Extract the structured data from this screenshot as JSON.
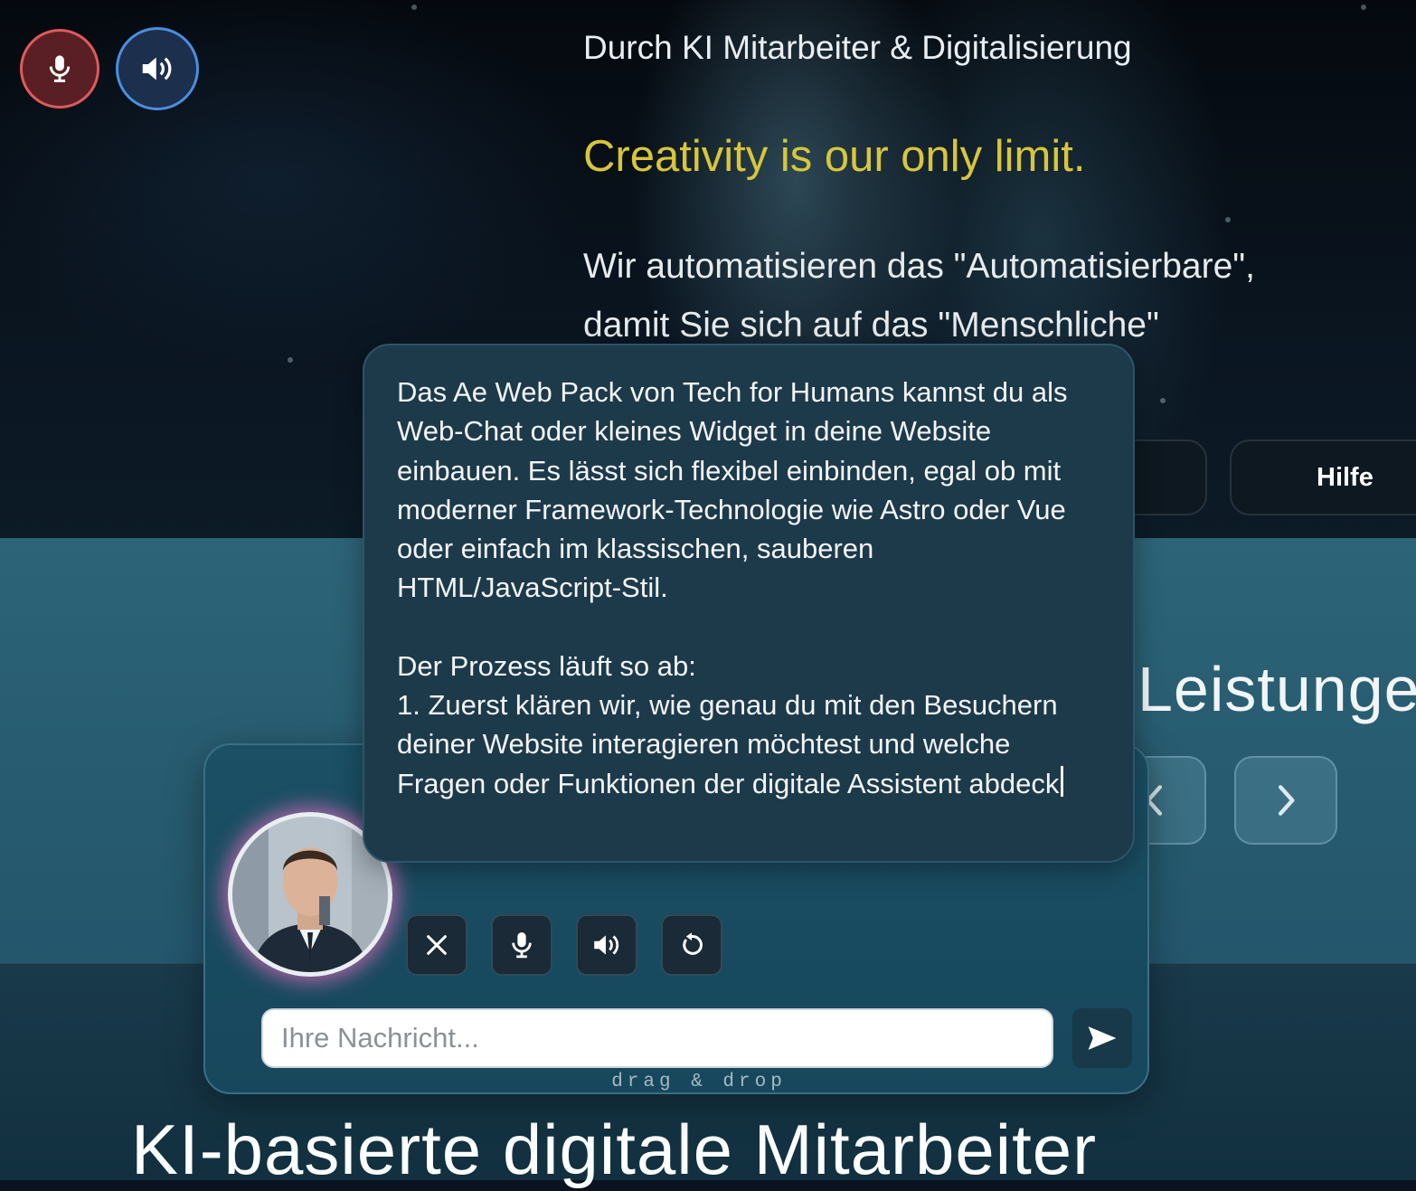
{
  "hero": {
    "title": "Durch KI Mitarbeiter & Digitalisierung",
    "slogan": "Creativity is our only limit.",
    "subtitle_line1": "Wir automatisieren das \"Automatisierbare\",",
    "subtitle_line2": "damit Sie sich auf das \"Menschliche\"",
    "help_label": "Hilfe"
  },
  "section": {
    "title": "Leistunge",
    "headline": "KI-basierte digitale Mitarbeiter"
  },
  "chat": {
    "message_p1": "Das Ae Web Pack von Tech for Humans kannst du als Web-Chat oder kleines Widget in deine Website einbauen. Es lässt sich flexibel einbinden, egal ob mit moderner Framework-Technologie wie Astro oder Vue oder einfach im klassischen, sauberen HTML/JavaScript-Stil.",
    "message_p2": "Der Prozess läuft so ab:",
    "message_p3": "1. Zuerst klären wir, wie genau du mit den Besuchern deiner Website interagieren möchtest und welche Fragen oder Funktionen der digitale Assistent abdeck",
    "input_placeholder": "Ihre Nachricht...",
    "drag_label": "drag & drop"
  },
  "colors": {
    "accent_yellow": "#d8c63a",
    "mic_red": "#e05a5a",
    "speaker_blue": "#4a8fe0",
    "avatar_glow": "#e66ebe"
  },
  "icons": {
    "mic": "mic-icon",
    "speaker": "speaker-icon",
    "close": "close-icon",
    "reload": "reload-icon",
    "send": "send-icon",
    "prev": "chevron-left-icon",
    "next": "chevron-right-icon"
  }
}
